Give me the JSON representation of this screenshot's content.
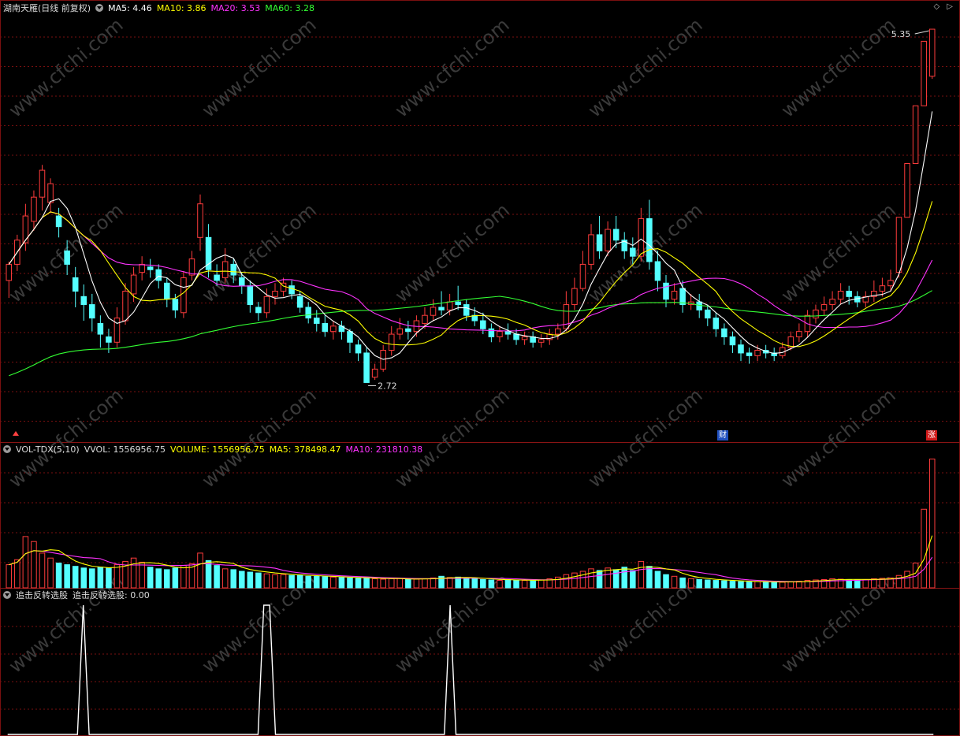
{
  "header": {
    "stock_title": "湖南天雁(日线 前复权)",
    "ma5": "MA5: 4.46",
    "ma10": "MA10: 3.86",
    "ma20": "MA20: 3.53",
    "ma60": "MA60: 3.28",
    "high_label": "5.35",
    "low_label": "2.72",
    "corner_icons": "◇ ▷"
  },
  "vol_header": {
    "name": "VOL-TDX(5,10)",
    "vvol": "VVOL: 1556956.75",
    "volume": "VOLUME: 1556956.75",
    "ma5": "MA5: 378498.47",
    "ma10": "MA10: 231810.38"
  },
  "ind_header": {
    "name": "追击反转选股",
    "value": "追击反转选股: 0.00"
  },
  "badges": {
    "cai": "财",
    "zhang": "涨"
  },
  "watermark": "www.cfchi.com",
  "colors": {
    "up": "#ff3c3c",
    "down": "#54ffff",
    "ma5": "#ffffff",
    "ma10": "#ffff00",
    "ma20": "#ff33ff",
    "ma60": "#33ff33",
    "grid": "#7a0f0f",
    "signal": "#ffffff"
  },
  "chart_data": [
    {
      "type": "candlestick",
      "title": "湖南天雁(日线 前复权)",
      "series_names": [
        "MA5",
        "MA10",
        "MA20",
        "MA60"
      ],
      "high": 5.35,
      "low": 2.72,
      "ylim": [
        2.4,
        5.45
      ],
      "candles": [
        [
          3.48,
          3.6,
          3.35,
          3.62
        ],
        [
          3.6,
          3.78,
          3.55,
          3.82
        ],
        [
          3.76,
          3.96,
          3.7,
          4.05
        ],
        [
          3.92,
          4.1,
          3.85,
          4.15
        ],
        [
          4.1,
          4.3,
          4.0,
          4.34
        ],
        [
          4.06,
          4.2,
          3.98,
          4.24
        ],
        [
          3.96,
          3.88,
          3.8,
          4.02
        ],
        [
          3.7,
          3.6,
          3.52,
          3.78
        ],
        [
          3.5,
          3.4,
          3.28,
          3.58
        ],
        [
          3.36,
          3.3,
          3.18,
          3.45
        ],
        [
          3.3,
          3.2,
          3.1,
          3.38
        ],
        [
          3.16,
          3.08,
          2.98,
          3.22
        ],
        [
          3.06,
          3.02,
          2.94,
          3.12
        ],
        [
          3.02,
          3.2,
          2.98,
          3.28
        ],
        [
          3.18,
          3.4,
          3.15,
          3.46
        ],
        [
          3.38,
          3.52,
          3.32,
          3.58
        ],
        [
          3.54,
          3.6,
          3.48,
          3.66
        ],
        [
          3.58,
          3.56,
          3.5,
          3.64
        ],
        [
          3.56,
          3.48,
          3.42,
          3.6
        ],
        [
          3.46,
          3.34,
          3.28,
          3.5
        ],
        [
          3.34,
          3.26,
          3.2,
          3.38
        ],
        [
          3.24,
          3.5,
          3.2,
          3.55
        ],
        [
          3.52,
          3.64,
          3.48,
          3.7
        ],
        [
          3.8,
          4.05,
          3.7,
          4.12
        ],
        [
          3.8,
          3.56,
          3.5,
          3.9
        ],
        [
          3.52,
          3.48,
          3.44,
          3.6
        ],
        [
          3.5,
          3.62,
          3.46,
          3.72
        ],
        [
          3.6,
          3.52,
          3.46,
          3.64
        ],
        [
          3.5,
          3.44,
          3.38,
          3.54
        ],
        [
          3.44,
          3.3,
          3.24,
          3.48
        ],
        [
          3.28,
          3.24,
          3.18,
          3.32
        ],
        [
          3.24,
          3.36,
          3.2,
          3.42
        ],
        [
          3.36,
          3.4,
          3.3,
          3.46
        ],
        [
          3.4,
          3.46,
          3.36,
          3.5
        ],
        [
          3.44,
          3.38,
          3.34,
          3.48
        ],
        [
          3.36,
          3.28,
          3.24,
          3.4
        ],
        [
          3.28,
          3.2,
          3.16,
          3.32
        ],
        [
          3.2,
          3.16,
          3.1,
          3.26
        ],
        [
          3.16,
          3.1,
          3.06,
          3.22
        ],
        [
          3.1,
          3.14,
          3.04,
          3.18
        ],
        [
          3.14,
          3.1,
          3.04,
          3.18
        ],
        [
          3.1,
          3.02,
          2.94,
          3.12
        ],
        [
          3.0,
          2.94,
          2.88,
          3.04
        ],
        [
          2.94,
          2.72,
          2.72,
          2.98
        ],
        [
          2.76,
          2.82,
          2.74,
          2.86
        ],
        [
          2.82,
          2.96,
          2.8,
          3.0
        ],
        [
          2.96,
          3.08,
          2.92,
          3.14
        ],
        [
          3.08,
          3.12,
          3.04,
          3.2
        ],
        [
          3.12,
          3.1,
          3.04,
          3.18
        ],
        [
          3.1,
          3.18,
          3.06,
          3.22
        ],
        [
          3.16,
          3.22,
          3.12,
          3.28
        ],
        [
          3.22,
          3.28,
          3.18,
          3.34
        ],
        [
          3.28,
          3.26,
          3.22,
          3.4
        ],
        [
          3.26,
          3.32,
          3.22,
          3.38
        ],
        [
          3.32,
          3.3,
          3.26,
          3.44
        ],
        [
          3.3,
          3.22,
          3.18,
          3.34
        ],
        [
          3.22,
          3.18,
          3.14,
          3.28
        ],
        [
          3.18,
          3.12,
          3.08,
          3.24
        ],
        [
          3.12,
          3.06,
          3.02,
          3.16
        ],
        [
          3.06,
          3.1,
          3.02,
          3.14
        ],
        [
          3.1,
          3.08,
          3.04,
          3.16
        ],
        [
          3.08,
          3.04,
          3.0,
          3.12
        ],
        [
          3.04,
          3.06,
          3.0,
          3.1
        ],
        [
          3.06,
          3.02,
          2.98,
          3.1
        ],
        [
          3.02,
          3.04,
          2.98,
          3.08
        ],
        [
          3.04,
          3.08,
          3.0,
          3.12
        ],
        [
          3.08,
          3.12,
          3.04,
          3.16
        ],
        [
          3.12,
          3.3,
          3.1,
          3.4
        ],
        [
          3.3,
          3.42,
          3.26,
          3.5
        ],
        [
          3.42,
          3.6,
          3.4,
          3.7
        ],
        [
          3.6,
          3.82,
          3.56,
          3.9
        ],
        [
          3.82,
          3.7,
          3.64,
          3.96
        ],
        [
          3.7,
          3.86,
          3.66,
          3.92
        ],
        [
          3.86,
          3.78,
          3.72,
          3.96
        ],
        [
          3.78,
          3.7,
          3.64,
          3.84
        ],
        [
          3.72,
          3.66,
          3.6,
          3.8
        ],
        [
          3.66,
          3.94,
          3.62,
          4.02
        ],
        [
          3.94,
          3.62,
          3.56,
          4.08
        ],
        [
          3.62,
          3.48,
          3.4,
          3.7
        ],
        [
          3.46,
          3.34,
          3.28,
          3.52
        ],
        [
          3.34,
          3.4,
          3.3,
          3.46
        ],
        [
          3.42,
          3.3,
          3.24,
          3.48
        ],
        [
          3.3,
          3.32,
          3.26,
          3.38
        ],
        [
          3.32,
          3.26,
          3.2,
          3.38
        ],
        [
          3.26,
          3.2,
          3.14,
          3.3
        ],
        [
          3.2,
          3.12,
          3.06,
          3.24
        ],
        [
          3.12,
          3.06,
          3.0,
          3.16
        ],
        [
          3.06,
          3.0,
          2.94,
          3.1
        ],
        [
          3.0,
          2.94,
          2.88,
          3.04
        ],
        [
          2.94,
          2.92,
          2.86,
          2.98
        ],
        [
          2.92,
          2.96,
          2.88,
          3.0
        ],
        [
          2.96,
          2.94,
          2.9,
          3.0
        ],
        [
          2.94,
          2.92,
          2.88,
          2.98
        ],
        [
          2.92,
          2.98,
          2.9,
          3.02
        ],
        [
          2.98,
          3.06,
          2.96,
          3.1
        ],
        [
          3.06,
          3.1,
          3.02,
          3.16
        ],
        [
          3.1,
          3.22,
          3.06,
          3.26
        ],
        [
          3.2,
          3.26,
          3.16,
          3.3
        ],
        [
          3.26,
          3.3,
          3.22,
          3.36
        ],
        [
          3.3,
          3.34,
          3.26,
          3.4
        ],
        [
          3.34,
          3.4,
          3.3,
          3.46
        ],
        [
          3.4,
          3.36,
          3.3,
          3.44
        ],
        [
          3.36,
          3.32,
          3.28,
          3.4
        ],
        [
          3.32,
          3.36,
          3.28,
          3.4
        ],
        [
          3.36,
          3.4,
          3.32,
          3.48
        ],
        [
          3.4,
          3.44,
          3.36,
          3.5
        ],
        [
          3.44,
          3.48,
          3.4,
          3.56
        ],
        [
          3.54,
          3.95,
          3.5,
          3.95
        ],
        [
          3.95,
          4.35,
          3.95,
          4.35
        ],
        [
          4.35,
          4.78,
          4.35,
          4.78
        ],
        [
          4.78,
          5.26,
          4.78,
          5.26
        ],
        [
          5.0,
          5.35,
          4.98,
          5.35
        ]
      ]
    },
    {
      "type": "bar",
      "title": "VOL-TDX(5,10)",
      "series_names": [
        "VOLUME",
        "MA5",
        "MA10"
      ],
      "ylim": [
        0,
        1600000
      ],
      "values": [
        280000,
        340000,
        620000,
        560000,
        420000,
        360000,
        300000,
        280000,
        260000,
        240000,
        230000,
        250000,
        240000,
        280000,
        320000,
        360000,
        310000,
        250000,
        230000,
        220000,
        240000,
        270000,
        290000,
        420000,
        330000,
        270000,
        230000,
        220000,
        200000,
        190000,
        180000,
        170000,
        160000,
        160000,
        150000,
        150000,
        140000,
        140000,
        135000,
        130000,
        125000,
        120000,
        115000,
        120000,
        110000,
        105000,
        110000,
        115000,
        100000,
        105000,
        110000,
        120000,
        140000,
        125000,
        130000,
        115000,
        110000,
        100000,
        95000,
        90000,
        100000,
        95000,
        90000,
        85000,
        95000,
        110000,
        130000,
        160000,
        180000,
        200000,
        230000,
        210000,
        240000,
        220000,
        250000,
        210000,
        320000,
        260000,
        200000,
        160000,
        140000,
        120000,
        110000,
        100000,
        95000,
        90000,
        85000,
        80000,
        75000,
        70000,
        75000,
        70000,
        72000,
        68000,
        75000,
        80000,
        90000,
        95000,
        100000,
        110000,
        105000,
        100000,
        95000,
        100000,
        110000,
        115000,
        120000,
        150000,
        200000,
        300000,
        950000,
        1556957
      ],
      "ma5": 378498.47,
      "ma10": 231810.38
    },
    {
      "type": "line",
      "title": "追击反转选股",
      "series_names": [
        "追击反转选股"
      ],
      "ylim": [
        0,
        1
      ],
      "values": [
        0,
        0,
        0,
        0,
        0,
        0,
        0,
        0,
        0,
        0,
        0,
        0,
        0,
        1,
        0,
        0,
        0,
        0,
        0,
        0,
        0,
        0,
        0,
        0,
        0,
        0,
        0,
        0,
        0,
        0,
        0,
        0,
        0,
        0,
        0,
        0,
        0,
        0,
        0,
        0,
        0,
        0,
        0,
        0,
        1,
        1,
        0,
        0,
        0,
        0,
        0,
        0,
        0,
        0,
        0,
        0,
        0,
        0,
        0,
        0,
        0,
        0,
        0,
        0,
        0,
        0,
        0,
        0,
        0,
        0,
        0,
        0,
        0,
        0,
        0,
        0,
        1,
        0,
        0,
        0,
        0,
        0,
        0,
        0,
        0,
        0,
        0,
        0,
        0,
        0,
        0,
        0,
        0,
        0,
        0,
        0,
        0,
        0,
        0,
        0,
        0,
        0,
        0,
        0,
        0,
        0,
        0,
        0,
        0,
        0,
        0,
        0,
        0,
        0,
        0,
        0,
        0,
        0,
        0,
        0,
        0,
        0,
        0,
        0,
        0,
        0,
        0,
        0,
        0,
        0,
        0,
        0,
        0,
        0,
        0,
        0,
        0,
        0,
        0,
        0,
        0,
        0,
        0,
        0,
        0,
        0,
        0,
        0,
        0,
        0,
        0,
        0,
        0,
        0,
        0,
        0,
        0,
        0,
        0,
        0
      ],
      "current": 0.0
    }
  ]
}
